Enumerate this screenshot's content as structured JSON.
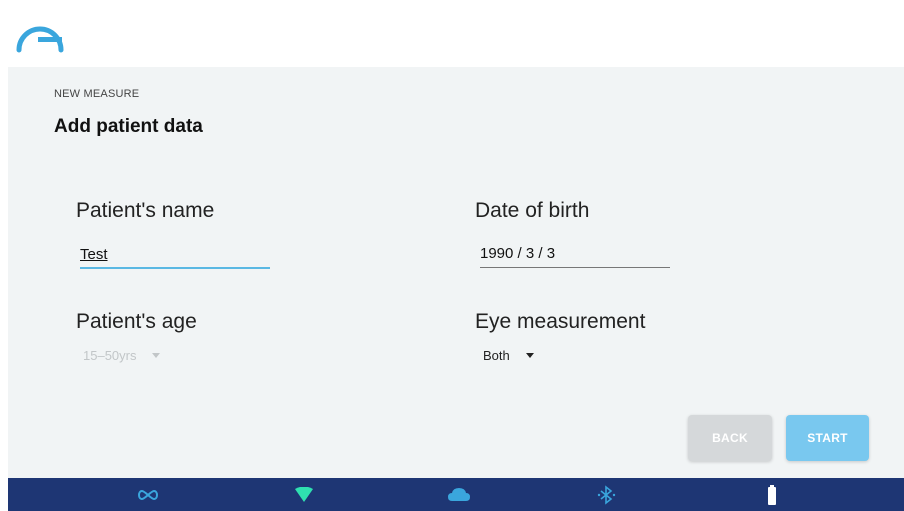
{
  "header": {
    "logo_icon": "arc-logo-icon",
    "brand_color": "#3aa6dd"
  },
  "page": {
    "eyebrow": "NEW MEASURE",
    "title": "Add patient data"
  },
  "form": {
    "patient_name": {
      "label": "Patient's name",
      "value": "Test"
    },
    "date_of_birth": {
      "label": "Date of birth",
      "value": "1990 / 3 / 3"
    },
    "patient_age": {
      "label": "Patient's age",
      "selected": "15–50yrs",
      "disabled": true
    },
    "eye_measurement": {
      "label": "Eye measurement",
      "selected": "Both"
    }
  },
  "actions": {
    "back_label": "BACK",
    "start_label": "START"
  },
  "statusbar": {
    "background": "#1e3674",
    "icons": [
      "infinity-link-icon",
      "wifi-icon",
      "cloud-icon",
      "bluetooth-icon",
      "battery-icon"
    ]
  },
  "colors": {
    "accent": "#5ab8e3",
    "start_button": "#79c8ef",
    "back_button": "#d5d8da",
    "panel_bg": "#f1f4f5"
  }
}
